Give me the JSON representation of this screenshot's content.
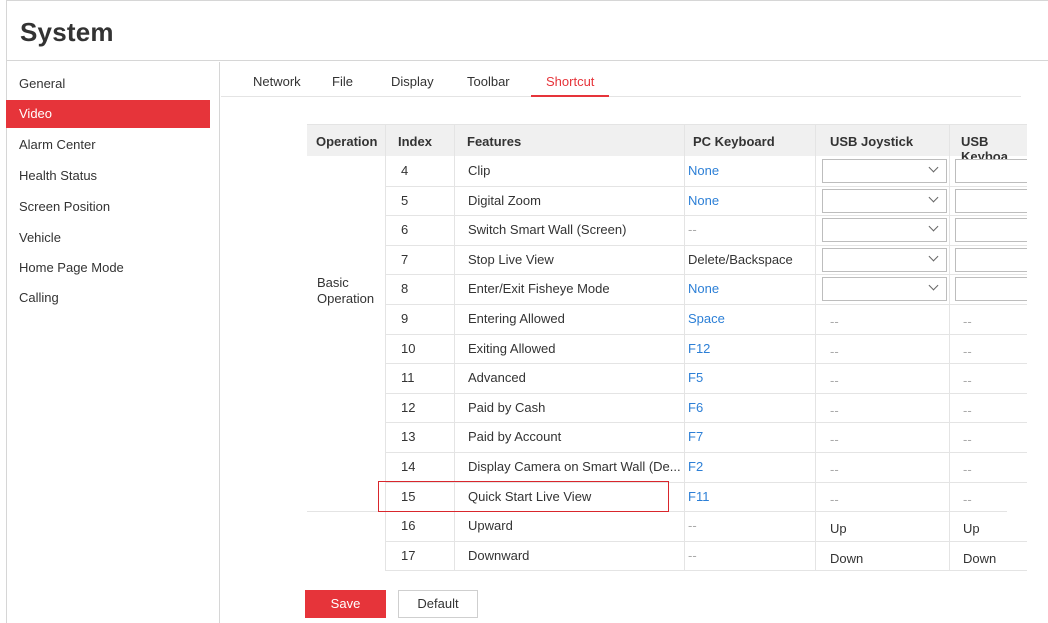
{
  "header": {
    "title": "System"
  },
  "sidebar": {
    "items": [
      {
        "label": "General"
      },
      {
        "label": "Video"
      },
      {
        "label": "Alarm Center"
      },
      {
        "label": "Health Status"
      },
      {
        "label": "Screen Position"
      },
      {
        "label": "Vehicle"
      },
      {
        "label": "Home Page Mode"
      },
      {
        "label": "Calling"
      }
    ],
    "active": "Video"
  },
  "tabs": [
    {
      "label": "Network"
    },
    {
      "label": "File"
    },
    {
      "label": "Display"
    },
    {
      "label": "Toolbar"
    },
    {
      "label": "Shortcut"
    }
  ],
  "active_tab": "Shortcut",
  "table": {
    "headers": {
      "operation": "Operation",
      "index": "Index",
      "features": "Features",
      "pc_keyboard": "PC Keyboard",
      "usb_joystick": "USB Joystick",
      "usb_keyboard": "USB Keyboa"
    },
    "group_label_line1": "Basic",
    "group_label_line2": "Operation",
    "rows": [
      {
        "index": "4",
        "feature": "Clip",
        "pc_keyboard": "None",
        "joystick": "",
        "usb_keyboard": ""
      },
      {
        "index": "5",
        "feature": "Digital Zoom",
        "pc_keyboard": "None",
        "joystick": "",
        "usb_keyboard": ""
      },
      {
        "index": "6",
        "feature": "Switch Smart Wall (Screen)",
        "pc_keyboard": "--",
        "joystick": "",
        "usb_keyboard": ""
      },
      {
        "index": "7",
        "feature": "Stop Live View",
        "pc_keyboard": "Delete/Backspace",
        "joystick": "",
        "usb_keyboard": ""
      },
      {
        "index": "8",
        "feature": "Enter/Exit Fisheye Mode",
        "pc_keyboard": "None",
        "joystick": "",
        "usb_keyboard": ""
      },
      {
        "index": "9",
        "feature": "Entering Allowed",
        "pc_keyboard": "Space",
        "joystick": "--",
        "usb_keyboard": "--"
      },
      {
        "index": "10",
        "feature": "Exiting Allowed",
        "pc_keyboard": "F12",
        "joystick": "--",
        "usb_keyboard": "--"
      },
      {
        "index": "11",
        "feature": "Advanced",
        "pc_keyboard": "F5",
        "joystick": "--",
        "usb_keyboard": "--"
      },
      {
        "index": "12",
        "feature": "Paid by Cash",
        "pc_keyboard": "F6",
        "joystick": "--",
        "usb_keyboard": "--"
      },
      {
        "index": "13",
        "feature": "Paid by Account",
        "pc_keyboard": "F7",
        "joystick": "--",
        "usb_keyboard": "--"
      },
      {
        "index": "14",
        "feature": "Display Camera on Smart Wall (De...",
        "pc_keyboard": "F2",
        "joystick": "--",
        "usb_keyboard": "--"
      },
      {
        "index": "15",
        "feature": "Quick Start Live View",
        "pc_keyboard": "F11",
        "joystick": "--",
        "usb_keyboard": "--"
      },
      {
        "index": "16",
        "feature": "Upward",
        "pc_keyboard": "--",
        "joystick": "Up",
        "usb_keyboard": "Up"
      },
      {
        "index": "17",
        "feature": "Downward",
        "pc_keyboard": "--",
        "joystick": "Down",
        "usb_keyboard": "Down"
      }
    ]
  },
  "buttons": {
    "save": "Save",
    "default": "Default"
  },
  "colors": {
    "accent": "#e6343a",
    "link": "#2c7fd6"
  }
}
